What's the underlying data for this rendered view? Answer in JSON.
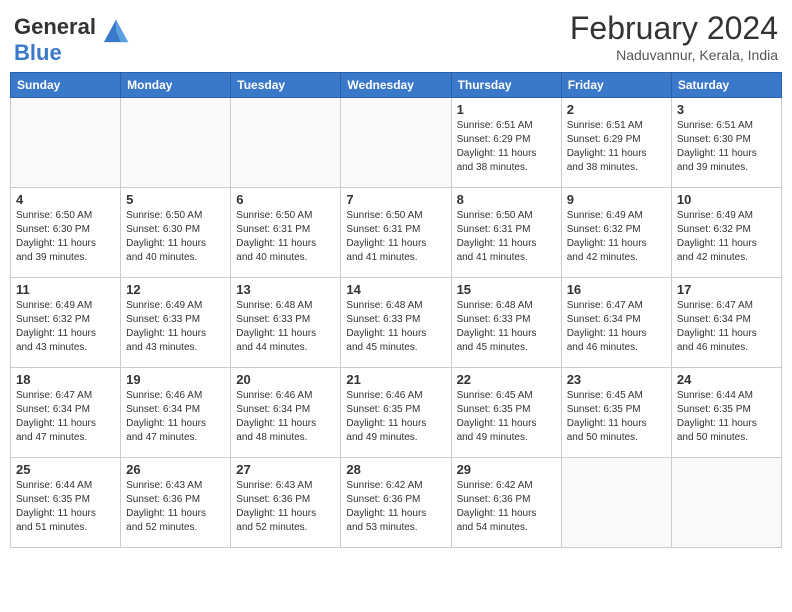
{
  "header": {
    "logo_line1": "General",
    "logo_line2": "Blue",
    "month_title": "February 2024",
    "subtitle": "Naduvannur, Kerala, India"
  },
  "weekdays": [
    "Sunday",
    "Monday",
    "Tuesday",
    "Wednesday",
    "Thursday",
    "Friday",
    "Saturday"
  ],
  "weeks": [
    [
      {
        "day": "",
        "info": ""
      },
      {
        "day": "",
        "info": ""
      },
      {
        "day": "",
        "info": ""
      },
      {
        "day": "",
        "info": ""
      },
      {
        "day": "1",
        "info": "Sunrise: 6:51 AM\nSunset: 6:29 PM\nDaylight: 11 hours\nand 38 minutes."
      },
      {
        "day": "2",
        "info": "Sunrise: 6:51 AM\nSunset: 6:29 PM\nDaylight: 11 hours\nand 38 minutes."
      },
      {
        "day": "3",
        "info": "Sunrise: 6:51 AM\nSunset: 6:30 PM\nDaylight: 11 hours\nand 39 minutes."
      }
    ],
    [
      {
        "day": "4",
        "info": "Sunrise: 6:50 AM\nSunset: 6:30 PM\nDaylight: 11 hours\nand 39 minutes."
      },
      {
        "day": "5",
        "info": "Sunrise: 6:50 AM\nSunset: 6:30 PM\nDaylight: 11 hours\nand 40 minutes."
      },
      {
        "day": "6",
        "info": "Sunrise: 6:50 AM\nSunset: 6:31 PM\nDaylight: 11 hours\nand 40 minutes."
      },
      {
        "day": "7",
        "info": "Sunrise: 6:50 AM\nSunset: 6:31 PM\nDaylight: 11 hours\nand 41 minutes."
      },
      {
        "day": "8",
        "info": "Sunrise: 6:50 AM\nSunset: 6:31 PM\nDaylight: 11 hours\nand 41 minutes."
      },
      {
        "day": "9",
        "info": "Sunrise: 6:49 AM\nSunset: 6:32 PM\nDaylight: 11 hours\nand 42 minutes."
      },
      {
        "day": "10",
        "info": "Sunrise: 6:49 AM\nSunset: 6:32 PM\nDaylight: 11 hours\nand 42 minutes."
      }
    ],
    [
      {
        "day": "11",
        "info": "Sunrise: 6:49 AM\nSunset: 6:32 PM\nDaylight: 11 hours\nand 43 minutes."
      },
      {
        "day": "12",
        "info": "Sunrise: 6:49 AM\nSunset: 6:33 PM\nDaylight: 11 hours\nand 43 minutes."
      },
      {
        "day": "13",
        "info": "Sunrise: 6:48 AM\nSunset: 6:33 PM\nDaylight: 11 hours\nand 44 minutes."
      },
      {
        "day": "14",
        "info": "Sunrise: 6:48 AM\nSunset: 6:33 PM\nDaylight: 11 hours\nand 45 minutes."
      },
      {
        "day": "15",
        "info": "Sunrise: 6:48 AM\nSunset: 6:33 PM\nDaylight: 11 hours\nand 45 minutes."
      },
      {
        "day": "16",
        "info": "Sunrise: 6:47 AM\nSunset: 6:34 PM\nDaylight: 11 hours\nand 46 minutes."
      },
      {
        "day": "17",
        "info": "Sunrise: 6:47 AM\nSunset: 6:34 PM\nDaylight: 11 hours\nand 46 minutes."
      }
    ],
    [
      {
        "day": "18",
        "info": "Sunrise: 6:47 AM\nSunset: 6:34 PM\nDaylight: 11 hours\nand 47 minutes."
      },
      {
        "day": "19",
        "info": "Sunrise: 6:46 AM\nSunset: 6:34 PM\nDaylight: 11 hours\nand 47 minutes."
      },
      {
        "day": "20",
        "info": "Sunrise: 6:46 AM\nSunset: 6:34 PM\nDaylight: 11 hours\nand 48 minutes."
      },
      {
        "day": "21",
        "info": "Sunrise: 6:46 AM\nSunset: 6:35 PM\nDaylight: 11 hours\nand 49 minutes."
      },
      {
        "day": "22",
        "info": "Sunrise: 6:45 AM\nSunset: 6:35 PM\nDaylight: 11 hours\nand 49 minutes."
      },
      {
        "day": "23",
        "info": "Sunrise: 6:45 AM\nSunset: 6:35 PM\nDaylight: 11 hours\nand 50 minutes."
      },
      {
        "day": "24",
        "info": "Sunrise: 6:44 AM\nSunset: 6:35 PM\nDaylight: 11 hours\nand 50 minutes."
      }
    ],
    [
      {
        "day": "25",
        "info": "Sunrise: 6:44 AM\nSunset: 6:35 PM\nDaylight: 11 hours\nand 51 minutes."
      },
      {
        "day": "26",
        "info": "Sunrise: 6:43 AM\nSunset: 6:36 PM\nDaylight: 11 hours\nand 52 minutes."
      },
      {
        "day": "27",
        "info": "Sunrise: 6:43 AM\nSunset: 6:36 PM\nDaylight: 11 hours\nand 52 minutes."
      },
      {
        "day": "28",
        "info": "Sunrise: 6:42 AM\nSunset: 6:36 PM\nDaylight: 11 hours\nand 53 minutes."
      },
      {
        "day": "29",
        "info": "Sunrise: 6:42 AM\nSunset: 6:36 PM\nDaylight: 11 hours\nand 54 minutes."
      },
      {
        "day": "",
        "info": ""
      },
      {
        "day": "",
        "info": ""
      }
    ]
  ]
}
